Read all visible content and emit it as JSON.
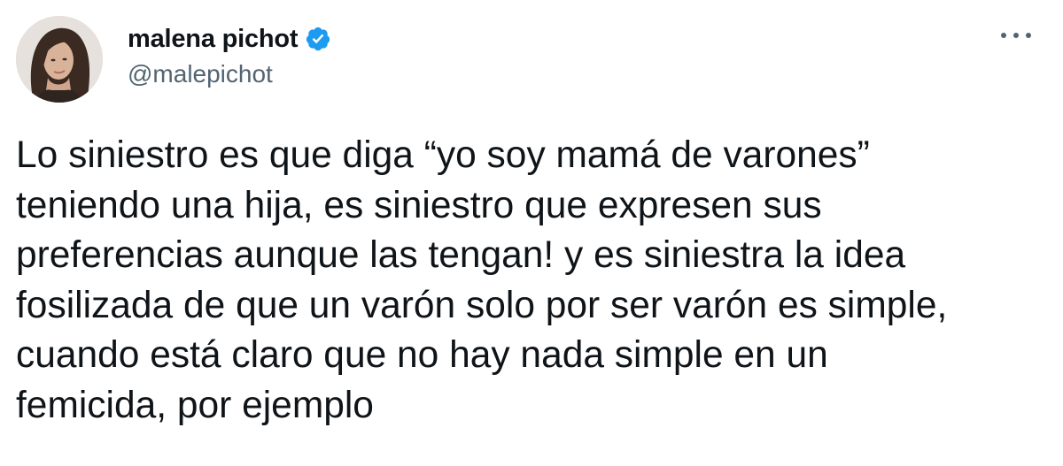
{
  "tweet": {
    "author": {
      "display_name": "malena pichot",
      "handle": "@malepichot",
      "verified": true,
      "verified_color": "#1d9bf0"
    },
    "menu_icon": "more-options-icon",
    "text_lines": [
      "Lo siniestro es que diga “yo soy mamá de varones”",
      "teniendo una hija, es siniestro que expresen sus",
      "preferencias aunque las tengan! y es siniestra la idea",
      "fosilizada de que un varón solo por ser varón es simple,",
      "cuando está claro que no hay nada simple en un",
      "femicida, por ejemplo"
    ]
  }
}
